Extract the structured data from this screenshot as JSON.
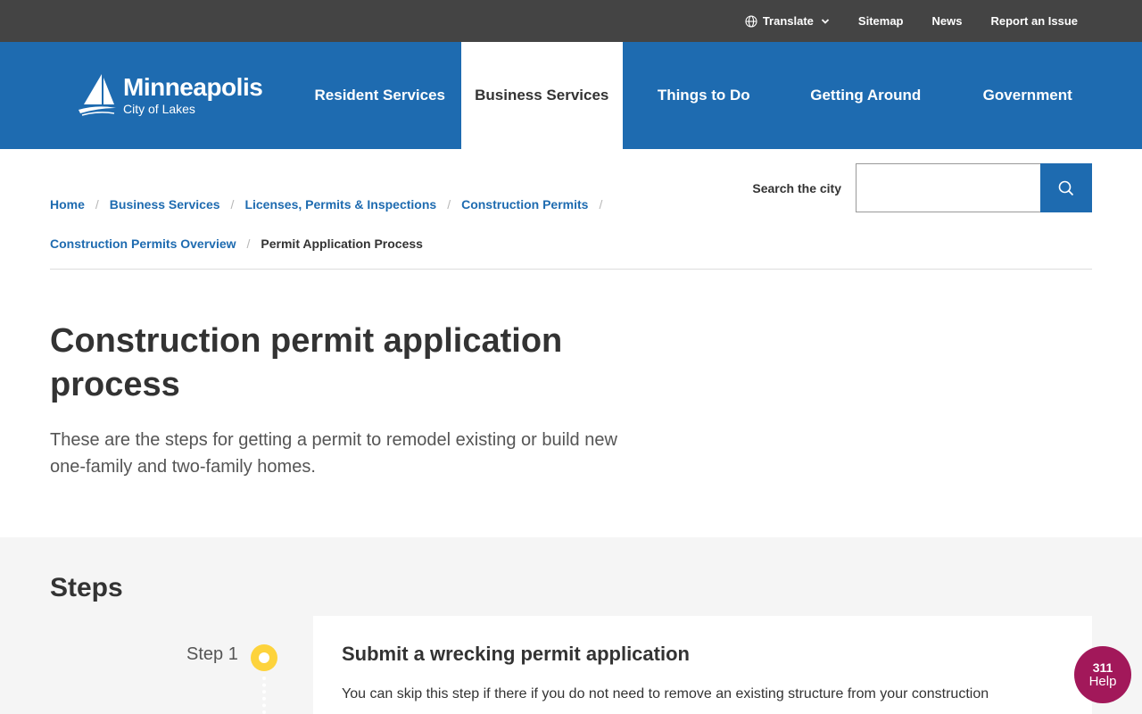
{
  "utility": {
    "translate": "Translate",
    "sitemap": "Sitemap",
    "news": "News",
    "report": "Report an Issue"
  },
  "logo": {
    "name": "Minneapolis",
    "tagline": "City of Lakes"
  },
  "nav": {
    "items": [
      {
        "label": "Resident Services"
      },
      {
        "label": "Business Services"
      },
      {
        "label": "Things to Do"
      },
      {
        "label": "Getting Around"
      },
      {
        "label": "Government"
      }
    ],
    "active": "Business Services"
  },
  "breadcrumb": {
    "items": [
      "Home",
      "Business Services",
      "Licenses, Permits & Inspections",
      "Construction Permits",
      "Construction Permits Overview"
    ],
    "current": "Permit Application Process"
  },
  "search": {
    "label": "Search the city",
    "value": ""
  },
  "page": {
    "title": "Construction permit application process",
    "lead": "These are the steps for getting a permit to remodel existing or build new one-family and two-family homes."
  },
  "steps": {
    "heading": "Steps",
    "items": [
      {
        "label": "Step 1",
        "title": "Submit a wrecking permit application",
        "text": "You can skip this step if there if you do not need to remove an existing structure from your construction"
      }
    ]
  },
  "help": {
    "number": "311",
    "label": "Help"
  },
  "colors": {
    "utility_bar": "#444444",
    "brand_blue": "#1e6bb0",
    "step_marker": "#fdd33c",
    "help_button": "#a2185a",
    "steps_background": "#f5f5f5"
  },
  "icons": [
    "globe-icon",
    "chevron-down-icon",
    "sailboat-logo-icon",
    "search-icon"
  ]
}
